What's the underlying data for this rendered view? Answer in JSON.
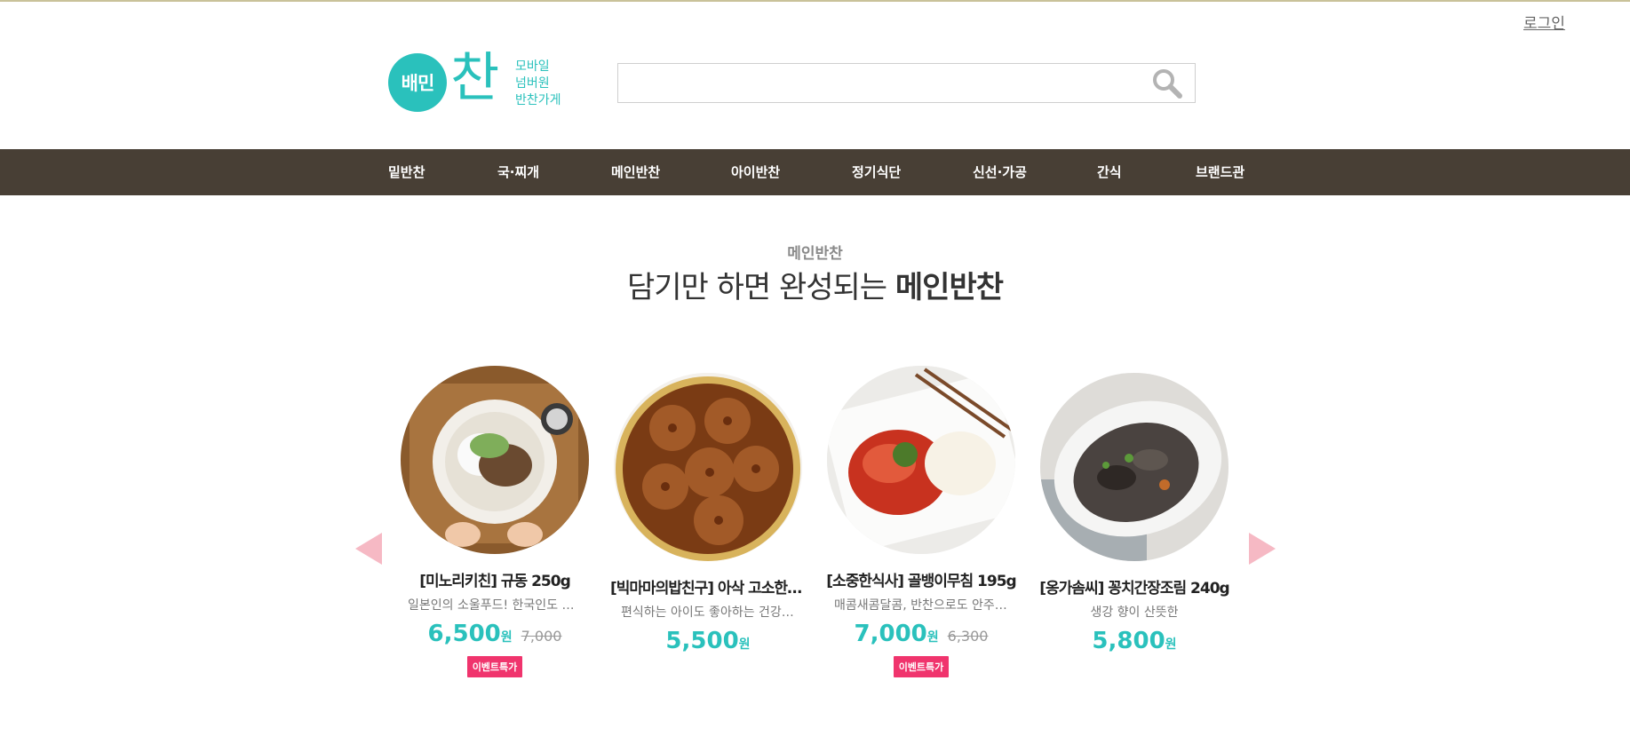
{
  "header": {
    "login_label": "로그인",
    "logo": {
      "badge": "배민",
      "mark": "찬",
      "tagline": [
        "모바일",
        "넘버원",
        "반찬가게"
      ]
    },
    "search": {
      "value": "",
      "placeholder": ""
    }
  },
  "nav": {
    "items": [
      {
        "label": "밑반찬"
      },
      {
        "label": "국·찌개"
      },
      {
        "label": "메인반찬"
      },
      {
        "label": "아이반찬"
      },
      {
        "label": "정기식단"
      },
      {
        "label": "신선·가공"
      },
      {
        "label": "간식"
      },
      {
        "label": "브랜드관"
      }
    ]
  },
  "section": {
    "subtitle": "메인반찬",
    "title_prefix": "담기만 하면 완성되는",
    "title_strong": "메인반찬"
  },
  "products": [
    {
      "name": "[미노리키친] 규동 250g",
      "desc": "일본인의 소울푸드! 한국인도 좋아하는 규동",
      "price": "6,500",
      "currency": "원",
      "original_price": "7,000",
      "badge": "이벤트특가"
    },
    {
      "name": "[빅마마의밥친구] 아삭 고소한 연근조림",
      "desc": "편식하는 아이도 좋아하는 건강반찬",
      "price": "5,500",
      "currency": "원",
      "original_price": "",
      "badge": ""
    },
    {
      "name": "[소중한식사] 골뱅이무침 195g",
      "desc": "매콤새콤달콤, 반찬으로도 안주로도",
      "price": "7,000",
      "currency": "원",
      "original_price": "6,300",
      "badge": "이벤트특가"
    },
    {
      "name": "[옹가솜씨] 꽁치간장조림 240g",
      "desc": "생강 향이 산뜻한",
      "price": "5,800",
      "currency": "원",
      "original_price": "",
      "badge": ""
    }
  ],
  "colors": {
    "brand": "#2ac1bc",
    "nav_bg": "#483f35",
    "badge": "#f0346d",
    "arrow": "#f6b9c4"
  }
}
